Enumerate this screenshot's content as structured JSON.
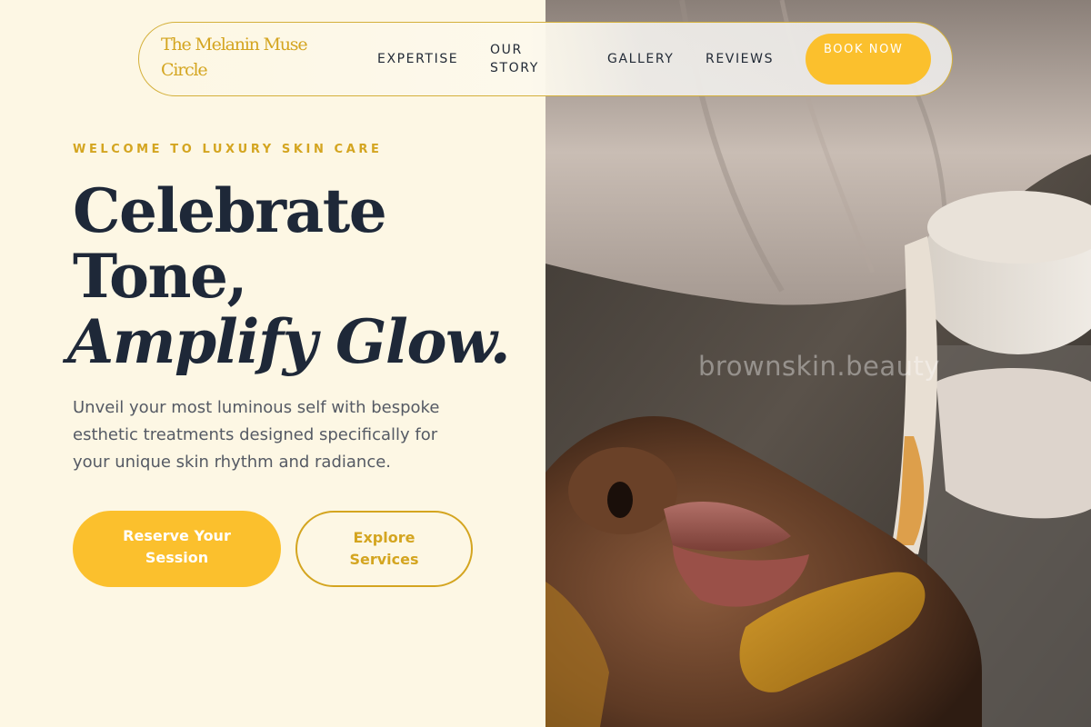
{
  "nav": {
    "logo": "The Melanin Muse Circle",
    "links": [
      "EXPERTISE",
      "OUR STORY",
      "GALLERY",
      "REVIEWS"
    ],
    "cta": "BOOK NOW"
  },
  "hero": {
    "eyebrow": "WELCOME TO LUXURY SKIN CARE",
    "headline_line1": "Celebrate",
    "headline_line2": "Tone,",
    "headline_line3": "Amplify Glow.",
    "subtext": "Unveil your most luminous self with bespoke esthetic treatments designed specifically for your unique skin rhythm and radiance.",
    "primary_cta": "Reserve Your Session",
    "secondary_cta": "Explore Services"
  },
  "image": {
    "watermark": "brownskin.beauty"
  },
  "colors": {
    "background": "#fdf7e4",
    "accent": "#fbc02d",
    "gold": "#d4a520",
    "heading": "#1e2838",
    "body_text": "#555a64"
  }
}
